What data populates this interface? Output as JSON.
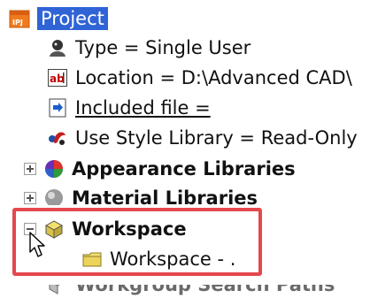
{
  "tree": {
    "root_label": "Project",
    "items": [
      {
        "label": "Type = Single User",
        "icon": "user-type-icon"
      },
      {
        "label": "Location = D:\\Advanced CAD\\",
        "icon": "location-ab-icon"
      },
      {
        "label": "Included file = ",
        "icon": "included-file-icon"
      },
      {
        "label": "Use Style Library = Read-Only",
        "icon": "style-library-icon"
      }
    ],
    "appearance_libraries": "Appearance Libraries",
    "material_libraries": "Material Libraries",
    "workspace": "Workspace",
    "workspace_child": "Workspace - .",
    "workgroup_paths": "Workgroup Search Paths"
  },
  "colors": {
    "selection": "#2f63d6",
    "highlight_box": "#e4474d"
  }
}
